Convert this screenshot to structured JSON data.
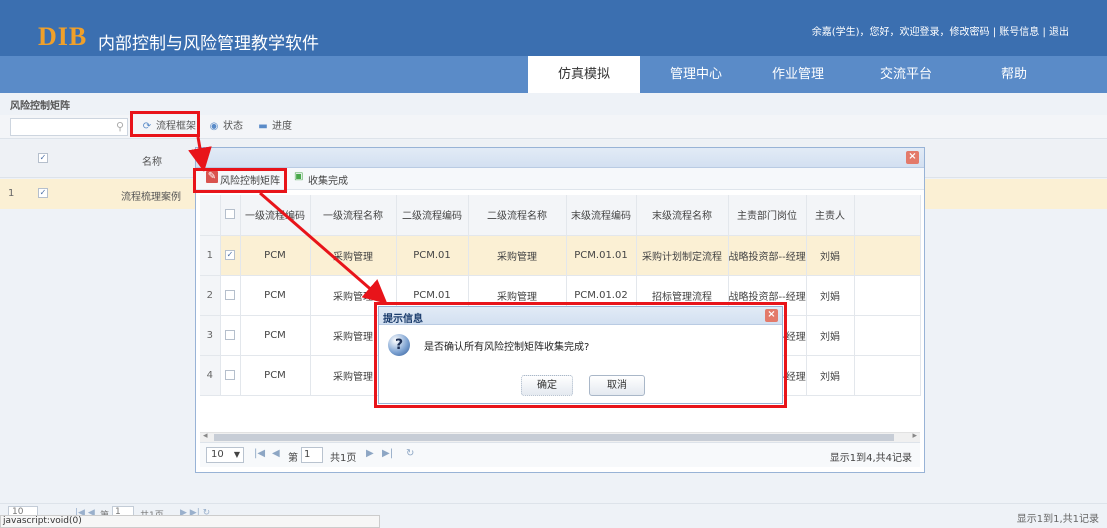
{
  "header": {
    "logo": "DIB",
    "app_title": "内部控制与风险管理教学软件",
    "user_bar": "余嘉(学生)，您好，欢迎登录，修改密码 | 账号信息 | 退出"
  },
  "nav": {
    "tabs": [
      {
        "label": "仿真模拟",
        "active": true
      },
      {
        "label": "管理中心",
        "active": false
      },
      {
        "label": "作业管理",
        "active": false
      },
      {
        "label": "交流平台",
        "active": false
      },
      {
        "label": "帮助",
        "active": false
      }
    ]
  },
  "outer": {
    "breadcrumb": "风险控制矩阵",
    "toolbar": {
      "flow_frame": "流程框架",
      "status": "状态",
      "progress": "进度"
    },
    "grid": {
      "col_name": "名称",
      "rows": [
        {
          "num": "1",
          "name": "流程梳理案例",
          "checked": true
        }
      ]
    },
    "pager": {
      "page_size": "10",
      "page_prefix": "第",
      "page_input": "1",
      "page_total": "共1页",
      "info": "显示1到1,共1记录"
    },
    "status_url": "javascript:void(0)"
  },
  "modal": {
    "toolbar": {
      "risk_matrix": "风险控制矩阵",
      "collect_done": "收集完成"
    },
    "columns": [
      "一级流程编码",
      "一级流程名称",
      "二级流程编码",
      "二级流程名称",
      "末级流程编码",
      "末级流程名称",
      "主责部门岗位",
      "主责人"
    ],
    "rows": [
      {
        "num": "1",
        "checked": true,
        "cells": [
          "PCM",
          "采购管理",
          "PCM.01",
          "采购管理",
          "PCM.01.01",
          "采购计划制定流程",
          "战略投资部--经理",
          "刘娟"
        ]
      },
      {
        "num": "2",
        "checked": false,
        "cells": [
          "PCM",
          "采购管理",
          "PCM.01",
          "采购管理",
          "PCM.01.02",
          "招标管理流程",
          "战略投资部--经理",
          "刘娟"
        ]
      },
      {
        "num": "3",
        "checked": false,
        "cells": [
          "PCM",
          "采购管理",
          "",
          "",
          "",
          "",
          "战略投资部--经理",
          "刘娟"
        ]
      },
      {
        "num": "4",
        "checked": false,
        "cells": [
          "PCM",
          "采购管理",
          "",
          "",
          "",
          "",
          "战略投资部--经理",
          "刘娟"
        ]
      }
    ],
    "pager": {
      "page_size": "10",
      "page_prefix": "第",
      "page_input": "1",
      "page_total": "共1页",
      "info": "显示1到4,共4记录"
    }
  },
  "confirm": {
    "title": "提示信息",
    "message": "是否确认所有风险控制矩阵收集完成?",
    "ok": "确定",
    "cancel": "取消"
  },
  "colors": {
    "header_bg": "#3b6fb0",
    "nav_bg": "#5a8bc8",
    "logo": "#f0a02a",
    "selected_row": "#fbf0d4",
    "annotation": "#e8141a"
  }
}
